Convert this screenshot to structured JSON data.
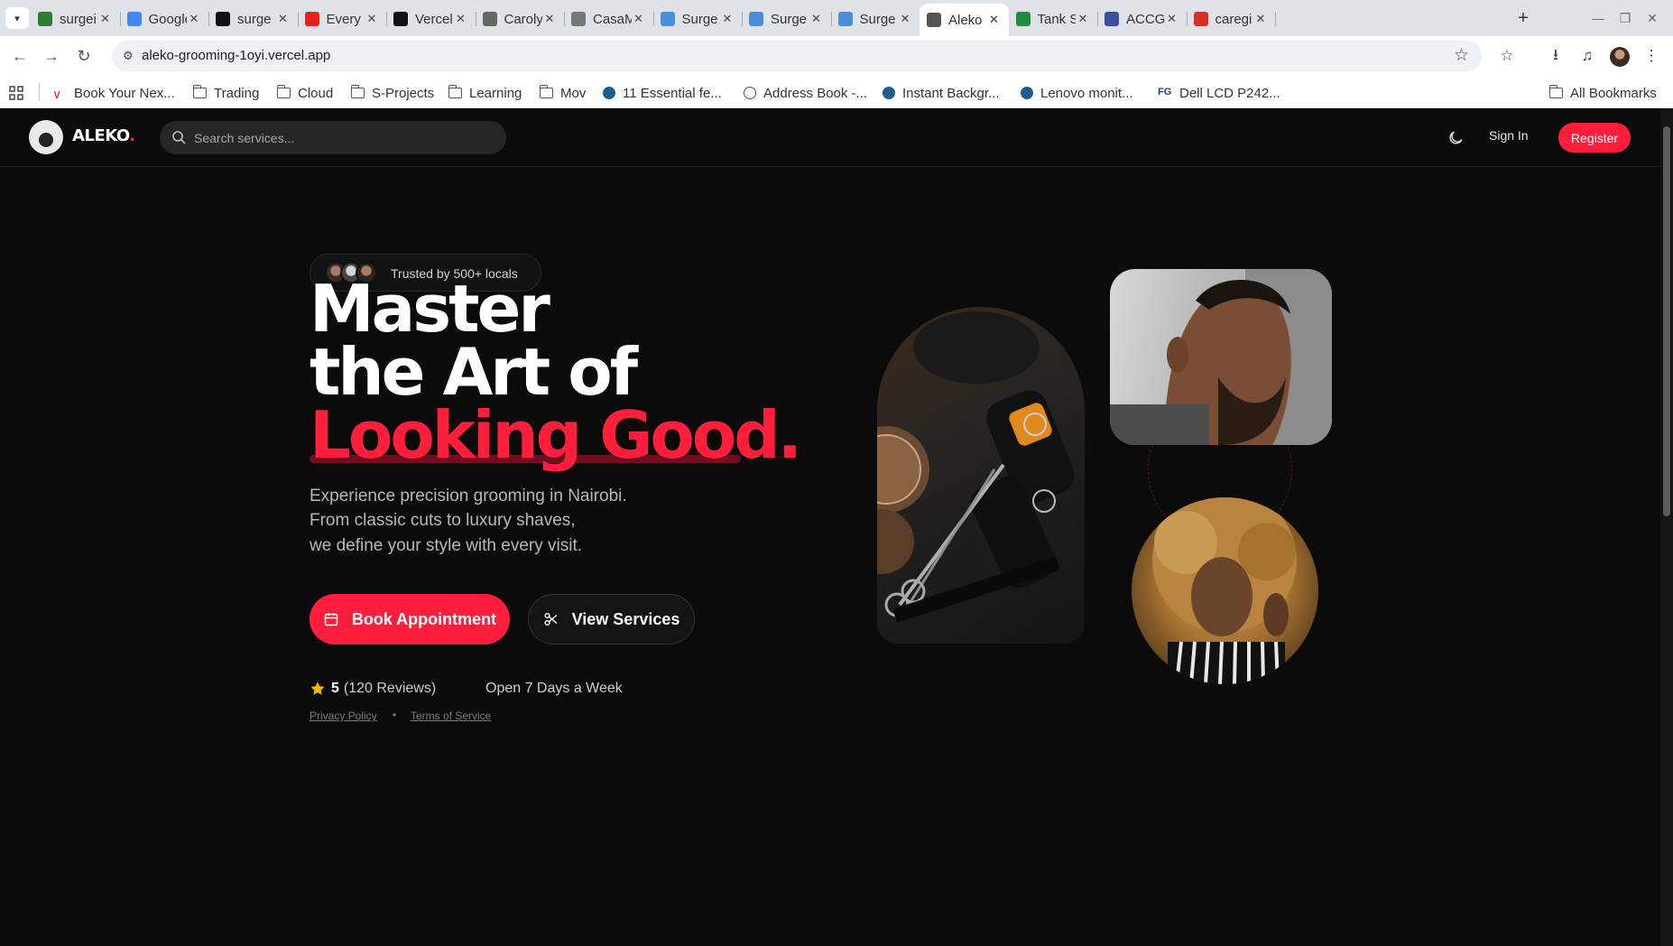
{
  "browser": {
    "tabs": [
      {
        "title": "surgei",
        "color": "#2e7d32"
      },
      {
        "title": "Google",
        "color": "#4285f4"
      },
      {
        "title": "surge",
        "color": "#111111"
      },
      {
        "title": "Every",
        "color": "#e62117"
      },
      {
        "title": "Vercel",
        "color": "#111111"
      },
      {
        "title": "Caroly",
        "color": "#666666"
      },
      {
        "title": "CasaM",
        "color": "#777777"
      },
      {
        "title": "Surge",
        "color": "#4a90d9"
      },
      {
        "title": "Surge",
        "color": "#4a90d9"
      },
      {
        "title": "Surge",
        "color": "#4a90d9"
      },
      {
        "title": "Aleko",
        "color": "#555555"
      },
      {
        "title": "Tank S",
        "color": "#1e8e3e"
      },
      {
        "title": "ACCGK",
        "color": "#3c4ea0"
      },
      {
        "title": "caregi",
        "color": "#d93025"
      }
    ],
    "url": "aleko-grooming-1oyi.vercel.app",
    "bookmarks": [
      {
        "label": "Book Your Nex...",
        "icon": "v-logo-icon"
      },
      {
        "label": "Trading",
        "icon": "folder-icon"
      },
      {
        "label": "Cloud",
        "icon": "folder-icon"
      },
      {
        "label": "S-Projects",
        "icon": "folder-icon"
      },
      {
        "label": "Learning",
        "icon": "folder-icon"
      },
      {
        "label": "Mov",
        "icon": "folder-icon"
      },
      {
        "label": "11 Essential fe...",
        "icon": "site-icon"
      },
      {
        "label": "Address Book -...",
        "icon": "globe-icon"
      },
      {
        "label": "Instant Backgr...",
        "icon": "site-icon"
      },
      {
        "label": "Lenovo monit...",
        "icon": "site-icon"
      },
      {
        "label": "Dell LCD P242...",
        "icon": "fg-icon"
      }
    ],
    "all_bookmarks": "All Bookmarks"
  },
  "site": {
    "brand": "ALEKO",
    "brand_dot": ".",
    "search_placeholder": "Search services...",
    "signin": "Sign In",
    "register": "Register"
  },
  "hero": {
    "trusted": "Trusted by 500+ locals",
    "headline_1": "Master",
    "headline_2": "the Art of",
    "headline_3": "Looking Good.",
    "para_1": "Experience precision grooming in Nairobi.",
    "para_2": "From classic cuts to luxury shaves,",
    "para_3": "we define your style with every visit.",
    "cta_primary": "Book Appointment",
    "cta_secondary": "View Services",
    "rating_score": "5",
    "rating_reviews": "(120 Reviews)",
    "open_days": "Open 7 Days a Week",
    "privacy": "Privacy Policy",
    "terms": "Terms of Service",
    "dot": "•"
  },
  "colors": {
    "accent": "#ff1f3d",
    "background": "#0b0b0b"
  }
}
